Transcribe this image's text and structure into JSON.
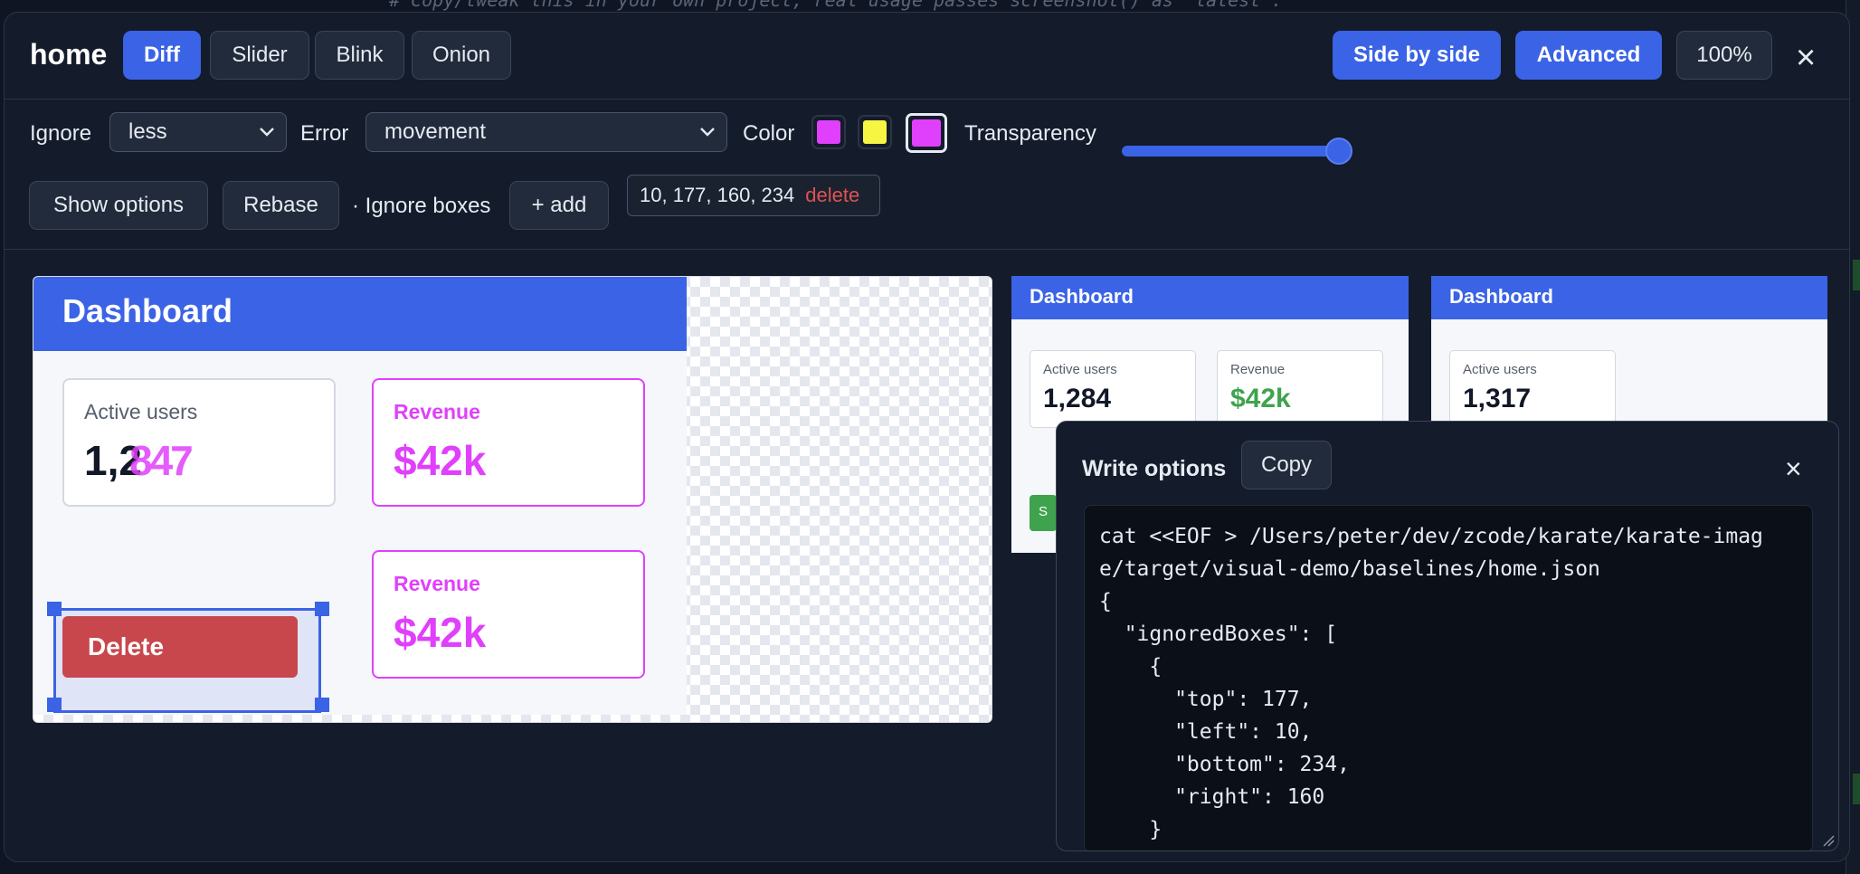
{
  "background": {
    "comment_line": "# Copy/tweak this in your own project, real usage passes screenshot() as 'latest'."
  },
  "header": {
    "title": "home",
    "modes": [
      "Diff",
      "Slider",
      "Blink",
      "Onion"
    ],
    "active_mode": "Diff",
    "side_by_side_label": "Side by side",
    "advanced_label": "Advanced",
    "zoom_label": "100%",
    "close_glyph": "×"
  },
  "toolbar": {
    "ignore_label": "Ignore",
    "ignore_value": "less",
    "error_label": "Error",
    "error_value": "movement",
    "color_label": "Color",
    "colors": [
      "#e040fb",
      "#f5f542",
      "#e040fb"
    ],
    "transparency_label": "Transparency",
    "transparency_value": 1.0,
    "show_options_label": "Show options",
    "rebase_label": "Rebase",
    "ignore_boxes_label": "· Ignore boxes",
    "add_label": "+ add",
    "box_value": "10, 177, 160, 234",
    "box_delete_label": "delete"
  },
  "diff_view": {
    "header_title": "Dashboard",
    "card1_label": "Active users",
    "card1_value": "1,2",
    "card1_diff_value": "847",
    "card2_label": "Revenue",
    "card2_value": "$42k",
    "card3_label": "Revenue",
    "card3_value": "$42k",
    "delete_label": "Delete"
  },
  "baseline_preview": {
    "header_title": "Dashboard",
    "card1_label": "Active users",
    "card1_value": "1,284",
    "card2_label": "Revenue",
    "card2_value": "$42k",
    "button_partial": "S"
  },
  "latest_preview": {
    "header_title": "Dashboard",
    "card1_label": "Active users",
    "card1_value": "1,317"
  },
  "write_options": {
    "title": "Write options",
    "copy_label": "Copy",
    "close_glyph": "×",
    "code_lines": [
      "cat <<EOF > /Users/peter/dev/zcode/karate/karate-imag",
      "e/target/visual-demo/baselines/home.json",
      "{",
      "  \"ignoredBoxes\": [",
      "    {",
      "      \"top\": 177,",
      "      \"left\": 10,",
      "      \"bottom\": 234,",
      "      \"right\": 160",
      "    }"
    ]
  },
  "colors": {
    "accent": "#3b63e6",
    "diff_magenta": "#e040fb",
    "danger": "#c8474d",
    "success": "#3fa34d"
  }
}
